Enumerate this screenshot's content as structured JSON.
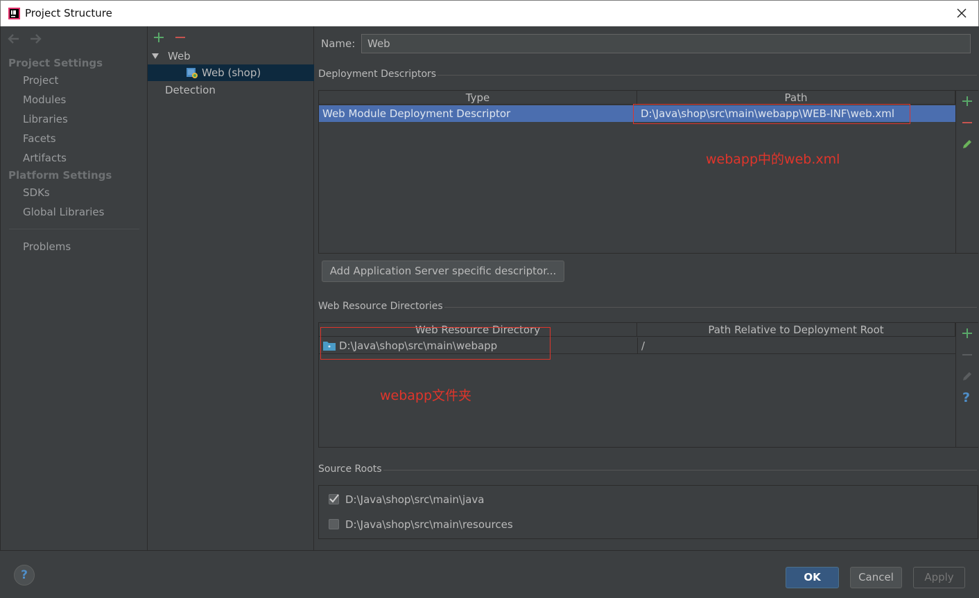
{
  "window": {
    "title": "Project Structure"
  },
  "sidebar": {
    "project_settings_header": "Project Settings",
    "project_items": [
      "Project",
      "Modules",
      "Libraries",
      "Facets",
      "Artifacts"
    ],
    "platform_settings_header": "Platform Settings",
    "platform_items": [
      "SDKs",
      "Global Libraries"
    ],
    "problems": "Problems"
  },
  "tree": {
    "root": "Web",
    "child": "Web (shop)",
    "detection": "Detection"
  },
  "form": {
    "name_label": "Name:",
    "name_value": "Web"
  },
  "deployment_descriptors": {
    "title": "Deployment Descriptors",
    "columns": [
      "Type",
      "Path"
    ],
    "rows": [
      {
        "type": "Web Module Deployment Descriptor",
        "path": "D:\\Java\\shop\\src\\main\\webapp\\WEB-INF\\web.xml"
      }
    ],
    "add_button": "Add Application Server specific descriptor...",
    "annotation": "webapp中的web.xml"
  },
  "web_resource_directories": {
    "title": "Web Resource Directories",
    "columns": [
      "Web Resource Directory",
      "Path Relative to Deployment Root"
    ],
    "rows": [
      {
        "directory": "D:\\Java\\shop\\src\\main\\webapp",
        "relative": "/"
      }
    ],
    "annotation": "webapp文件夹"
  },
  "source_roots": {
    "title": "Source Roots",
    "items": [
      {
        "path": "D:\\Java\\shop\\src\\main\\java",
        "checked": true
      },
      {
        "path": "D:\\Java\\shop\\src\\main\\resources",
        "checked": false
      }
    ]
  },
  "footer": {
    "help": "?",
    "ok": "OK",
    "cancel": "Cancel",
    "apply": "Apply"
  },
  "colors": {
    "selection": "#4b6eaf",
    "tree_selection": "#0d293e",
    "annotation": "#e0352b",
    "add_green": "#59a869",
    "remove_red": "#c75450"
  }
}
